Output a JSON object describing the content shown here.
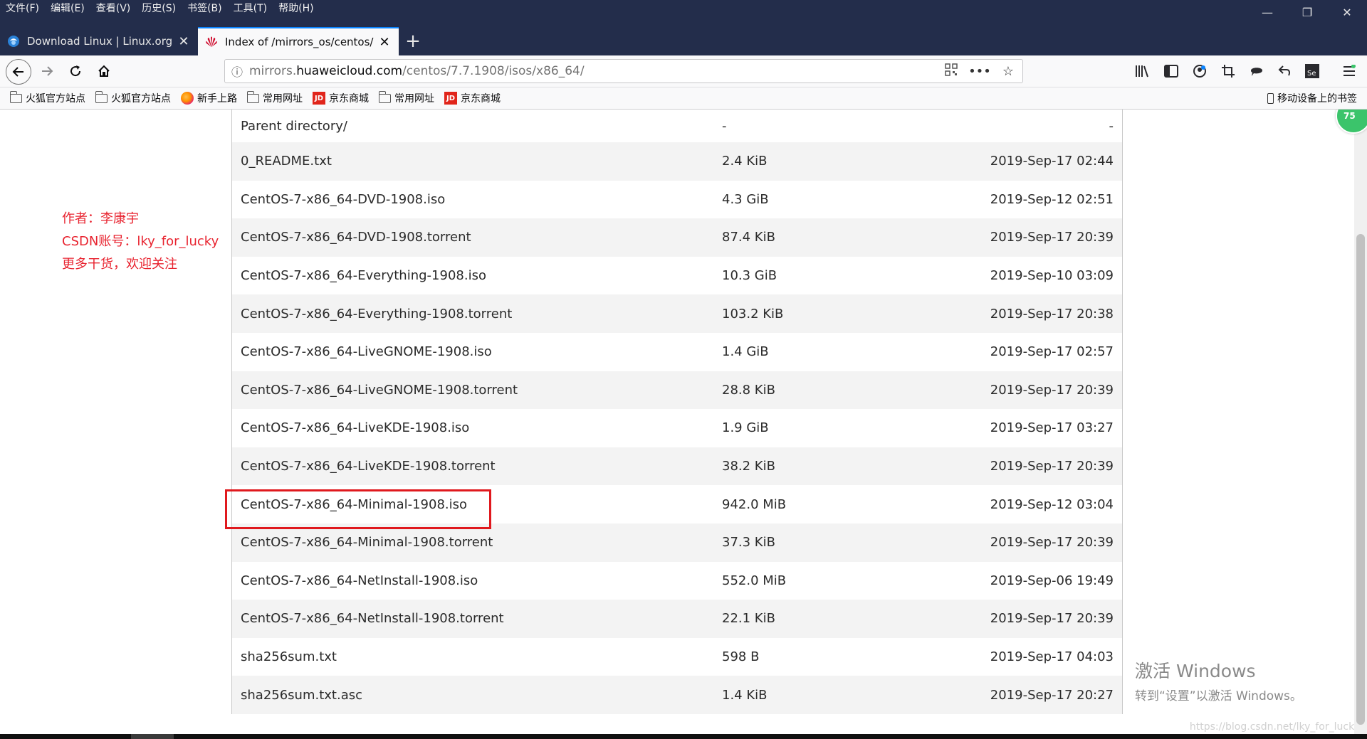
{
  "menu": [
    "文件(F)",
    "编辑(E)",
    "查看(V)",
    "历史(S)",
    "书签(B)",
    "工具(T)",
    "帮助(H)"
  ],
  "window_controls": {
    "minimize": "—",
    "restore": "❐",
    "close": "✕"
  },
  "tabs": [
    {
      "title": "Download Linux | Linux.org",
      "favicon": "linux-org-icon",
      "close": "✕"
    },
    {
      "title": "Index of /mirrors_os/centos/",
      "favicon": "huawei-icon",
      "close": "✕"
    }
  ],
  "new_tab": "+",
  "url": {
    "prefix": "mirrors.",
    "domain": "huaweicloud.com",
    "path": "/centos/7.7.1908/isos/x86_64/"
  },
  "bookmarks": [
    {
      "type": "folder",
      "label": "火狐官方站点"
    },
    {
      "type": "folder",
      "label": "火狐官方站点"
    },
    {
      "type": "firefox",
      "label": "新手上路"
    },
    {
      "type": "folder",
      "label": "常用网址"
    },
    {
      "type": "jd",
      "label": "京东商城"
    },
    {
      "type": "folder",
      "label": "常用网址"
    },
    {
      "type": "jd",
      "label": "京东商城"
    }
  ],
  "jd_icon_text": "JD",
  "mobile_bookmarks": "移动设备上的书签",
  "extension_badge": "75",
  "files": [
    {
      "name": "Parent directory/",
      "size": "-",
      "date": "-"
    },
    {
      "name": "0_README.txt",
      "size": "2.4 KiB",
      "date": "2019-Sep-17 02:44"
    },
    {
      "name": "CentOS-7-x86_64-DVD-1908.iso",
      "size": "4.3 GiB",
      "date": "2019-Sep-12 02:51"
    },
    {
      "name": "CentOS-7-x86_64-DVD-1908.torrent",
      "size": "87.4 KiB",
      "date": "2019-Sep-17 20:39"
    },
    {
      "name": "CentOS-7-x86_64-Everything-1908.iso",
      "size": "10.3 GiB",
      "date": "2019-Sep-10 03:09"
    },
    {
      "name": "CentOS-7-x86_64-Everything-1908.torrent",
      "size": "103.2 KiB",
      "date": "2019-Sep-17 20:38"
    },
    {
      "name": "CentOS-7-x86_64-LiveGNOME-1908.iso",
      "size": "1.4 GiB",
      "date": "2019-Sep-17 02:57"
    },
    {
      "name": "CentOS-7-x86_64-LiveGNOME-1908.torrent",
      "size": "28.8 KiB",
      "date": "2019-Sep-17 20:39"
    },
    {
      "name": "CentOS-7-x86_64-LiveKDE-1908.iso",
      "size": "1.9 GiB",
      "date": "2019-Sep-17 03:27"
    },
    {
      "name": "CentOS-7-x86_64-LiveKDE-1908.torrent",
      "size": "38.2 KiB",
      "date": "2019-Sep-17 20:39"
    },
    {
      "name": "CentOS-7-x86_64-Minimal-1908.iso",
      "size": "942.0 MiB",
      "date": "2019-Sep-12 03:04"
    },
    {
      "name": "CentOS-7-x86_64-Minimal-1908.torrent",
      "size": "37.3 KiB",
      "date": "2019-Sep-17 20:39"
    },
    {
      "name": "CentOS-7-x86_64-NetInstall-1908.iso",
      "size": "552.0 MiB",
      "date": "2019-Sep-06 19:49"
    },
    {
      "name": "CentOS-7-x86_64-NetInstall-1908.torrent",
      "size": "22.1 KiB",
      "date": "2019-Sep-17 20:39"
    },
    {
      "name": "sha256sum.txt",
      "size": "598 B",
      "date": "2019-Sep-17 04:03"
    },
    {
      "name": "sha256sum.txt.asc",
      "size": "1.4 KiB",
      "date": "2019-Sep-17 20:27"
    }
  ],
  "highlighted_file": "CentOS-7-x86_64-Minimal-1908.iso",
  "author_note": [
    "作者：李康宇",
    "CSDN账号：lky_for_lucky",
    "更多干货，欢迎关注"
  ],
  "activate_windows": {
    "title": "激活 Windows",
    "subtitle": "转到“设置”以激活 Windows。"
  },
  "watermark": "https://blog.csdn.net/lky_for_lucky",
  "colors": {
    "tab_accent": "#0a84ff",
    "highlight_red": "#e0191e",
    "note_red": "#e8232f",
    "chrome_dark": "#232d4b"
  }
}
